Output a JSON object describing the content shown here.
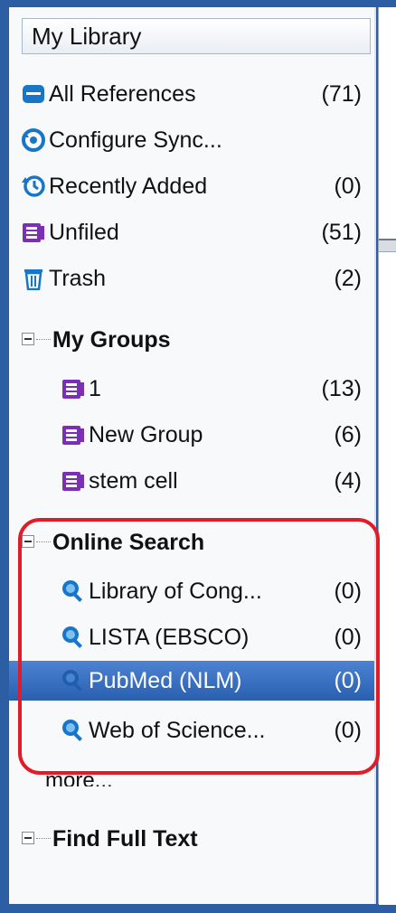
{
  "my_library": {
    "title": "My Library"
  },
  "library_items": [
    {
      "label": "All References",
      "count": "(71)",
      "icon": "all-references-icon"
    },
    {
      "label": "Configure Sync...",
      "count": "",
      "icon": "sync-icon"
    },
    {
      "label": "Recently Added",
      "count": "(0)",
      "icon": "recent-icon"
    },
    {
      "label": "Unfiled",
      "count": "(51)",
      "icon": "unfiled-icon"
    },
    {
      "label": "Trash",
      "count": "(2)",
      "icon": "trash-icon"
    }
  ],
  "my_groups": {
    "title": "My Groups",
    "items": [
      {
        "label": "1",
        "count": "(13)",
        "icon": "group-icon"
      },
      {
        "label": "New Group",
        "count": "(6)",
        "icon": "group-icon"
      },
      {
        "label": "stem cell",
        "count": "(4)",
        "icon": "group-icon"
      }
    ]
  },
  "online_search": {
    "title": "Online Search",
    "items": [
      {
        "label": "Library of Cong...",
        "count": "(0)",
        "icon": "online-search-icon"
      },
      {
        "label": "LISTA (EBSCO)",
        "count": "(0)",
        "icon": "online-search-icon"
      },
      {
        "label": "PubMed (NLM)",
        "count": "(0)",
        "icon": "online-search-icon",
        "selected": true
      },
      {
        "label": "Web of Science...",
        "count": "(0)",
        "icon": "online-search-icon"
      }
    ],
    "more_label": "more..."
  },
  "find_full_text": {
    "title": "Find Full Text"
  },
  "colors": {
    "selection": "#2a5fb0",
    "highlight_ring": "#e01b2a",
    "frame": "#2d5ea4"
  }
}
